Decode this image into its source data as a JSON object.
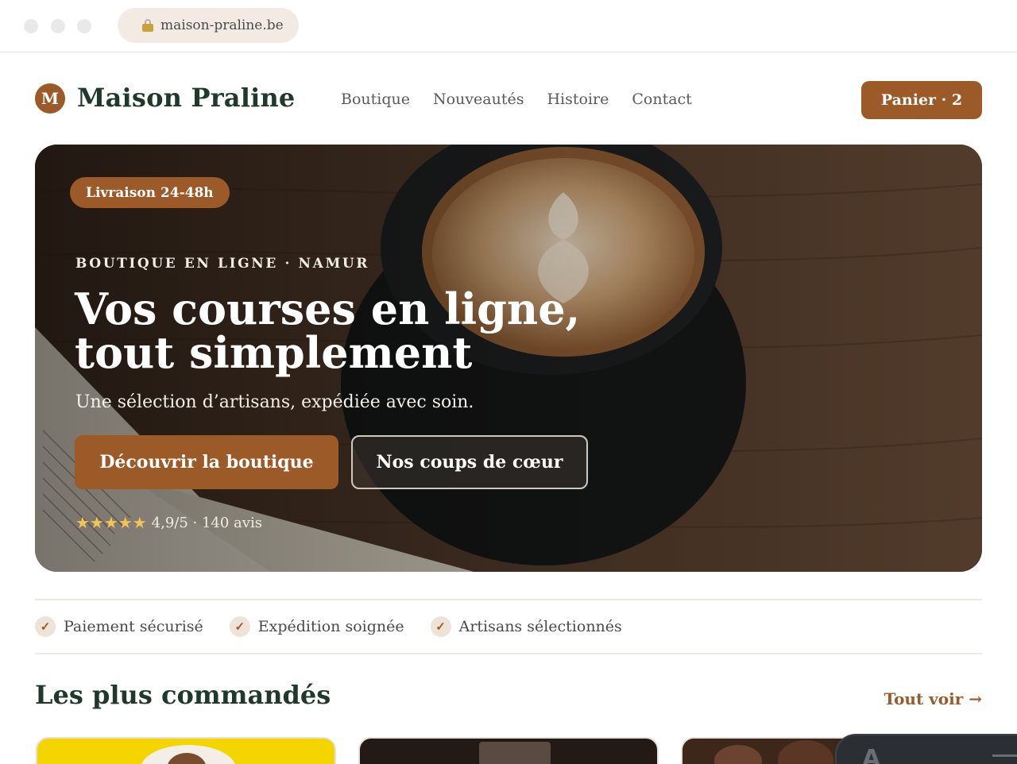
{
  "browser": {
    "url": "maison-praline.be"
  },
  "header": {
    "logo_letter": "M",
    "brand": "Maison Praline",
    "nav": [
      "Boutique",
      "Nouveautés",
      "Histoire",
      "Contact"
    ],
    "cart_label": "Panier · 2"
  },
  "hero": {
    "badge": "Livraison 24-48h",
    "eyebrow": "BOUTIQUE EN LIGNE · NAMUR",
    "title": "Vos courses en ligne, tout simplement",
    "subtitle": "Une sélection d’artisans, expédiée avec soin.",
    "primary_button": "Découvrir la boutique",
    "secondary_button": "Nos coups de cœur",
    "stars": "★★★★★",
    "rating_text": "4,9/5 · 140 avis",
    "rating_value": 4.9
  },
  "trust": [
    {
      "check": "✓",
      "label": "Paiement sécurisé"
    },
    {
      "check": "✓",
      "label": "Expédition soignée"
    },
    {
      "check": "✓",
      "label": "Artisans sélectionnés"
    }
  ],
  "section": {
    "title": "Les plus commandés",
    "see_all": "Tout voir →"
  },
  "colors": {
    "accent": "#9b5a28",
    "heading": "#1f3a2c",
    "star": "#f2c453"
  },
  "icons": [
    "lock-icon",
    "check-icon",
    "star-icon",
    "arrow-right-icon"
  ]
}
